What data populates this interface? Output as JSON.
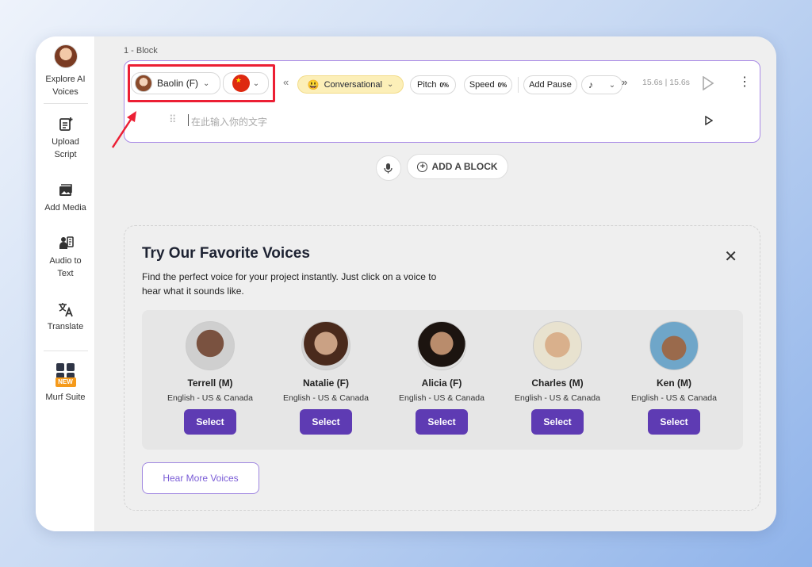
{
  "sidebar": {
    "items": [
      {
        "label_1": "Explore AI",
        "label_2": "Voices",
        "icon": "ai-voice-avatar"
      },
      {
        "label_1": "Upload",
        "label_2": "Script",
        "icon": "upload-script-icon"
      },
      {
        "label_1": "Add Media",
        "label_2": "",
        "icon": "add-media-icon"
      },
      {
        "label_1": "Audio to",
        "label_2": "Text",
        "icon": "audio-to-text-icon"
      },
      {
        "label_1": "Translate",
        "label_2": "",
        "icon": "translate-icon"
      },
      {
        "label_1": "Murf Suite",
        "label_2": "",
        "icon": "murf-suite-icon",
        "badge": "NEW"
      }
    ]
  },
  "block": {
    "label": "1 -  Block",
    "voice_name": "Baolin (F)",
    "voice_style": "Conversational",
    "pitch_label": "Pitch",
    "pitch_value": "0%",
    "speed_label": "Speed",
    "speed_value": "0%",
    "add_pause_label": "Add Pause",
    "duration": "15.6s | 15.6s",
    "placeholder": "在此输入你的文字"
  },
  "add_block_label": "ADD A BLOCK",
  "favorites": {
    "title": "Try Our Favorite Voices",
    "description": "Find the perfect voice for your project instantly. Just click on a voice to hear what it sounds like.",
    "voices": [
      {
        "name": "Terrell (M)",
        "lang": "English - US & Canada",
        "button": "Select",
        "skin": "#7a5240"
      },
      {
        "name": "Natalie (F)",
        "lang": "English - US & Canada",
        "button": "Select",
        "skin": "#caa184"
      },
      {
        "name": "Alicia (F)",
        "lang": "English - US & Canada",
        "button": "Select",
        "skin": "#b98c6c"
      },
      {
        "name": "Charles (M)",
        "lang": "English - US & Canada",
        "button": "Select",
        "skin": "#d9b08c"
      },
      {
        "name": "Ken (M)",
        "lang": "English - US & Canada",
        "button": "Select",
        "skin": "#9a6a4c"
      }
    ],
    "more_button": "Hear More Voices"
  },
  "colors": {
    "accent": "#5e3bb3",
    "highlight": "#ec1f34"
  }
}
